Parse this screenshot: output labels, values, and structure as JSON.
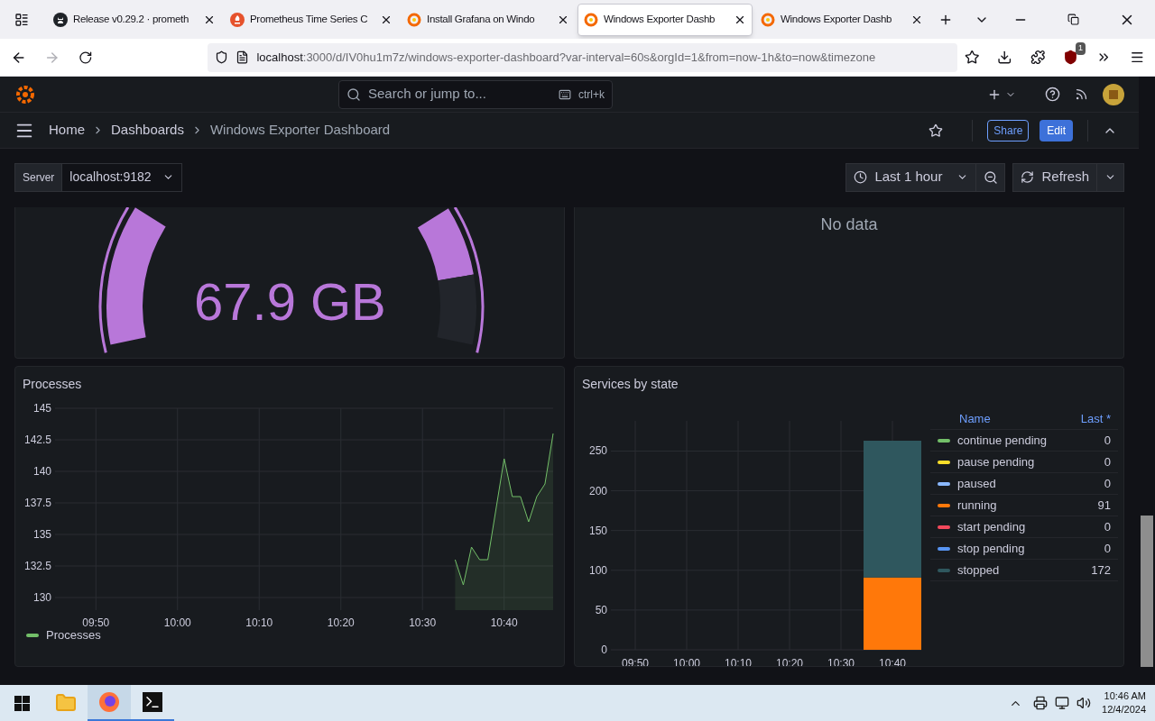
{
  "browser": {
    "tabs": [
      {
        "kind": "github",
        "label": "Release v0.29.2 · prometh",
        "selected": false
      },
      {
        "kind": "prometheus",
        "label": "Prometheus Time Series C",
        "selected": false
      },
      {
        "kind": "grafana",
        "label": "Install Grafana on Windo",
        "selected": false
      },
      {
        "kind": "grafana",
        "label": "Windows Exporter Dashb",
        "selected": true
      },
      {
        "kind": "grafana",
        "label": "Windows Exporter Dashb",
        "selected": false
      }
    ],
    "url_host": "localhost",
    "url_rest": ":3000/d/IV0hu1m7z/windows-exporter-dashboard?var-interval=60s&orgId=1&from=now-1h&to=now&timezone",
    "extension_badge": "1"
  },
  "topbar": {
    "search_placeholder": "Search or jump to...",
    "shortcut": "ctrl+k"
  },
  "breadcrumbs": [
    {
      "label": "Home",
      "current": false
    },
    {
      "label": "Dashboards",
      "current": false
    },
    {
      "label": "Windows Exporter Dashboard",
      "current": true
    }
  ],
  "actions": {
    "share": "Share",
    "edit": "Edit"
  },
  "variables": [
    {
      "label": "Server",
      "value": "localhost:9182"
    }
  ],
  "time_picker": {
    "range": "Last 1 hour",
    "refresh": "Refresh"
  },
  "gauge_panel": {
    "value": "67.9 GB"
  },
  "nodata_panel": {
    "message": "No data"
  },
  "processes_panel": {
    "title": "Processes",
    "chart_data": {
      "type": "area",
      "grid": true,
      "ylim": [
        129,
        145
      ],
      "categories": [
        null,
        null,
        null,
        null,
        null,
        "09:50",
        null,
        null,
        null,
        null,
        null,
        null,
        null,
        null,
        null,
        "10:00",
        null,
        null,
        null,
        null,
        null,
        null,
        null,
        null,
        null,
        "10:10",
        null,
        null,
        null,
        null,
        null,
        null,
        null,
        null,
        null,
        "10:20",
        null,
        null,
        null,
        null,
        null,
        null,
        null,
        null,
        null,
        "10:30",
        null,
        null,
        null,
        null,
        null,
        null,
        null,
        null,
        null,
        "10:40",
        null,
        null,
        null,
        null,
        null,
        null
      ],
      "yticks": [
        130,
        132.5,
        135,
        137.5,
        140,
        142.5,
        145
      ],
      "series": [
        {
          "name": "Processes",
          "color": "#73bf69",
          "values": [
            null,
            null,
            null,
            null,
            null,
            null,
            null,
            null,
            null,
            null,
            null,
            null,
            null,
            null,
            null,
            null,
            null,
            null,
            null,
            null,
            null,
            null,
            null,
            null,
            null,
            null,
            null,
            null,
            null,
            null,
            null,
            null,
            null,
            null,
            null,
            null,
            null,
            null,
            null,
            null,
            null,
            null,
            null,
            null,
            null,
            null,
            null,
            null,
            null,
            133,
            131,
            134,
            133,
            133,
            137,
            141,
            138,
            138,
            136,
            138,
            139,
            143
          ]
        }
      ]
    }
  },
  "services_panel": {
    "title": "Services by state",
    "legend_columns": [
      "Name",
      "Last *"
    ],
    "legend_last": [
      "0",
      "0",
      "0",
      "91",
      "0",
      "0",
      "172"
    ],
    "chart_data": {
      "type": "bar",
      "stacked": true,
      "grid": true,
      "categories": [
        "09:50",
        "10:00",
        "10:10",
        "10:20",
        "10:30",
        "10:40"
      ],
      "ylim": [
        0,
        263
      ],
      "yticks": [
        0,
        50,
        100,
        150,
        200,
        250
      ],
      "series": [
        {
          "name": "continue pending",
          "color": "#73bf69",
          "values": [
            null,
            null,
            null,
            null,
            null,
            0
          ]
        },
        {
          "name": "pause pending",
          "color": "#fade2a",
          "values": [
            null,
            null,
            null,
            null,
            null,
            0
          ]
        },
        {
          "name": "paused",
          "color": "#8ab8ff",
          "values": [
            null,
            null,
            null,
            null,
            null,
            0
          ]
        },
        {
          "name": "running",
          "color": "#ff780a",
          "values": [
            null,
            null,
            null,
            null,
            null,
            91
          ]
        },
        {
          "name": "start pending",
          "color": "#f2495c",
          "values": [
            null,
            null,
            null,
            null,
            null,
            0
          ]
        },
        {
          "name": "stop pending",
          "color": "#5794f2",
          "values": [
            null,
            null,
            null,
            null,
            null,
            0
          ]
        },
        {
          "name": "stopped",
          "color": "#2f575e",
          "values": [
            null,
            null,
            null,
            null,
            null,
            172
          ]
        }
      ]
    }
  },
  "taskbar": {
    "time": "10:46 AM",
    "date": "12/4/2024"
  }
}
